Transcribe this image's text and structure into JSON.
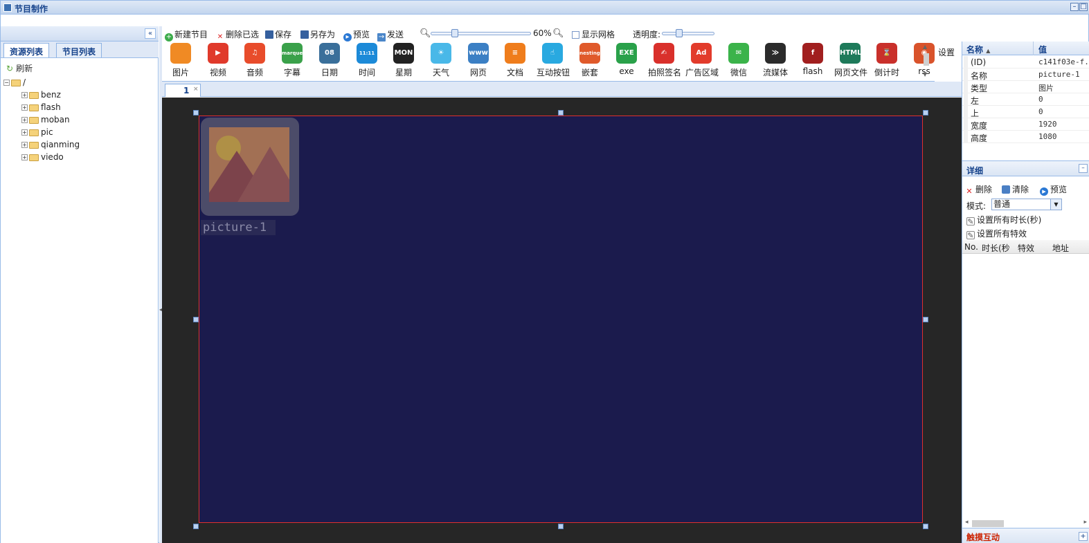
{
  "window": {
    "title": "节目制作",
    "controls": [
      "–",
      "□",
      "×"
    ]
  },
  "left_panel": {
    "collapse_glyph": "«",
    "tabs": [
      {
        "label": "资源列表"
      },
      {
        "label": "节目列表"
      }
    ],
    "refresh_label": "刷新",
    "tree": {
      "root": "/",
      "children": [
        "benz",
        "flash",
        "moban",
        "pic",
        "qianming",
        "viedo"
      ]
    }
  },
  "toolbar": {
    "new_program": "新建节目",
    "delete_selected": "删除已选",
    "save": "保存",
    "save_as": "另存为",
    "preview": "预览",
    "send": "发送",
    "zoom_level": "60%",
    "zoom_fraction": 0.22,
    "show_grid": "显示网格",
    "opacity_label": "透明度:",
    "opacity_fraction": 0.3
  },
  "widgets": [
    {
      "label": "图片",
      "icon": "image-icon",
      "color": "#f08a24",
      "glyph": ""
    },
    {
      "label": "视频",
      "icon": "video-icon",
      "color": "#e03a2b",
      "glyph": "▶"
    },
    {
      "label": "音频",
      "icon": "music-icon",
      "color": "#e84c2b",
      "glyph": "♫"
    },
    {
      "label": "字幕",
      "icon": "marquee-icon",
      "color": "#3aa14a",
      "glyph": "marquee"
    },
    {
      "label": "日期",
      "icon": "calendar-icon",
      "color": "#3a6f9a",
      "glyph": "08"
    },
    {
      "label": "时间",
      "icon": "clock-icon",
      "color": "#1c8ad8",
      "glyph": "11:11"
    },
    {
      "label": "星期",
      "icon": "weekday-icon",
      "color": "#222222",
      "glyph": "MON"
    },
    {
      "label": "天气",
      "icon": "weather-icon",
      "color": "#49b8e8",
      "glyph": "☀"
    },
    {
      "label": "网页",
      "icon": "web-icon",
      "color": "#3b7fc4",
      "glyph": "www"
    },
    {
      "label": "文档",
      "icon": "document-icon",
      "color": "#ef7d1c",
      "glyph": "≡"
    },
    {
      "label": "互动按钮",
      "icon": "touch-button-icon",
      "color": "#29a9e0",
      "glyph": "☝"
    },
    {
      "label": "嵌套",
      "icon": "nesting-icon",
      "color": "#e05a2b",
      "glyph": "nesting"
    },
    {
      "label": "exe",
      "icon": "exe-icon",
      "color": "#2aa14a",
      "glyph": "EXE"
    },
    {
      "label": "拍照签名",
      "icon": "camera-sign-icon",
      "color": "#d9302b",
      "glyph": "✍"
    },
    {
      "label": "广告区域",
      "icon": "ad-icon",
      "color": "#e23b2b",
      "glyph": "Ad"
    },
    {
      "label": "微信",
      "icon": "wechat-icon",
      "color": "#3bb34a",
      "glyph": "✉"
    },
    {
      "label": "流媒体",
      "icon": "stream-icon",
      "color": "#2b2b2b",
      "glyph": "≫"
    },
    {
      "label": "flash",
      "icon": "flash-icon",
      "color": "#a11f1f",
      "glyph": "f"
    },
    {
      "label": "网页文件",
      "icon": "html-icon",
      "color": "#1e7a5a",
      "glyph": "HTML"
    },
    {
      "label": "倒计时",
      "icon": "hourglass-icon",
      "color": "#c9302b",
      "glyph": "⌛"
    },
    {
      "label": "rss",
      "icon": "rss-icon",
      "color": "#d9532b",
      "glyph": "◉"
    }
  ],
  "settings_label": "设置",
  "program_tabs": [
    {
      "label": "1",
      "close": "×"
    }
  ],
  "canvas": {
    "background": "#1b1b4d",
    "element": {
      "caption": "picture-1"
    }
  },
  "properties": {
    "header_name": "名称",
    "header_sort": "▲",
    "header_value": "值",
    "rows": [
      {
        "key": "(ID)",
        "value": "c141f03e-f..."
      },
      {
        "key": "名称",
        "value": "picture-1"
      },
      {
        "key": "类型",
        "value": "图片"
      },
      {
        "key": "左",
        "value": "0"
      },
      {
        "key": "上",
        "value": "0"
      },
      {
        "key": "宽度",
        "value": "1920"
      },
      {
        "key": "高度",
        "value": "1080"
      }
    ]
  },
  "detail": {
    "title": "详细",
    "collapse_glyph": "–",
    "delete": "删除",
    "clear": "清除",
    "preview": "预览",
    "mode_label": "模式:",
    "mode_value": "普通",
    "set_all_duration": "设置所有时长(秒)",
    "set_all_effects": "设置所有特效",
    "columns": [
      "No.",
      "时长(秒",
      "特效",
      "地址"
    ]
  },
  "interaction": {
    "title": "触摸互动",
    "expand_glyph": "+"
  }
}
